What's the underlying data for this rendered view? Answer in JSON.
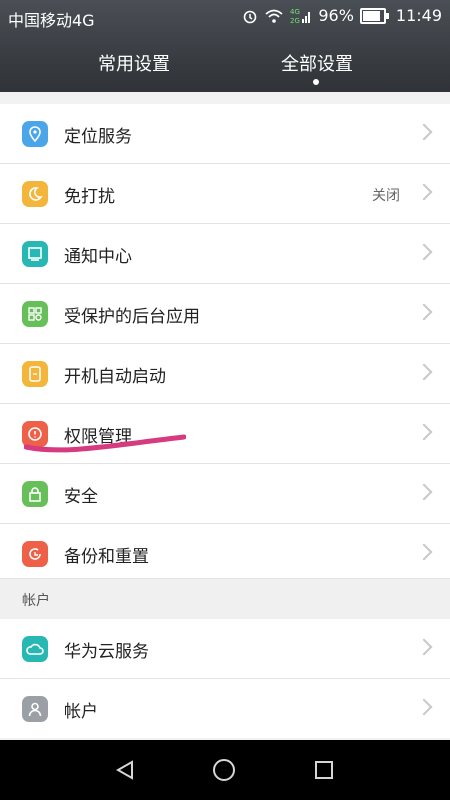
{
  "status_bar": {
    "carrier": "中国移动4G",
    "battery_percent": "96%",
    "time": "11:49",
    "battery_level": 0.96
  },
  "tabs": [
    {
      "label": "常用设置",
      "selected": false
    },
    {
      "label": "全部设置",
      "selected": true
    }
  ],
  "settings": {
    "items": [
      {
        "label": "定位服务",
        "icon": "location-icon",
        "color": "#4aa6e8"
      },
      {
        "label": "免打扰",
        "value": "关闭",
        "icon": "moon-icon",
        "color": "#f4b63a"
      },
      {
        "label": "通知中心",
        "icon": "notification-icon",
        "color": "#27b8b3"
      },
      {
        "label": "受保护的后台应用",
        "icon": "apps-protect-icon",
        "color": "#67bf5a"
      },
      {
        "label": "开机自动启动",
        "icon": "startup-icon",
        "color": "#f4b63a"
      },
      {
        "label": "权限管理",
        "icon": "permission-icon",
        "color": "#ee6047"
      },
      {
        "label": "安全",
        "icon": "lock-icon",
        "color": "#67bf5a"
      },
      {
        "label": "备份和重置",
        "icon": "backup-icon",
        "color": "#ee6047"
      }
    ]
  },
  "account_section": {
    "header": "帐户",
    "items": [
      {
        "label": "华为云服务",
        "icon": "cloud-icon",
        "color": "#27b8b3"
      },
      {
        "label": "帐户",
        "icon": "user-icon",
        "color": "#9aa0a6"
      }
    ]
  },
  "colors": {
    "top_bar": "#3b3f44",
    "underline_mark": "#d63a7f"
  }
}
